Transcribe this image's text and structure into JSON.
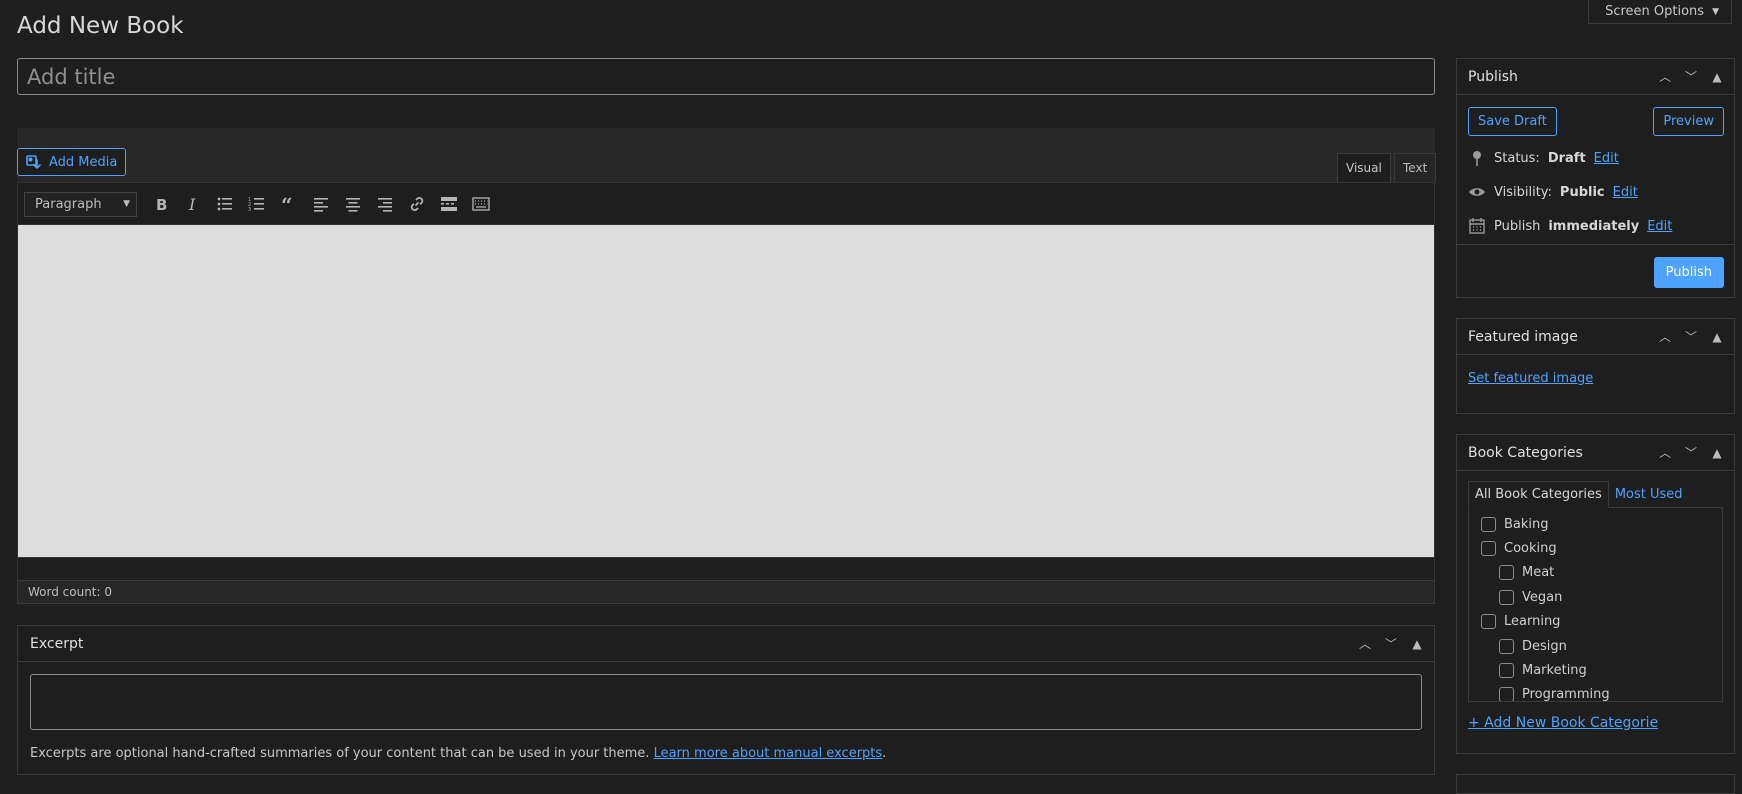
{
  "screen_options": {
    "label": "Screen Options"
  },
  "page": {
    "title": "Add New Book"
  },
  "title_field": {
    "placeholder": "Add title",
    "value": ""
  },
  "editor": {
    "add_media_label": "Add Media",
    "tabs": {
      "visual": "Visual",
      "text": "Text"
    },
    "format_select": "Paragraph",
    "word_count": "Word count: 0"
  },
  "excerpt": {
    "title": "Excerpt",
    "help_text": "Excerpts are optional hand-crafted summaries of your content that can be used in your theme. ",
    "help_link": "Learn more about manual excerpts",
    "help_end": "."
  },
  "publish": {
    "title": "Publish",
    "save_draft": "Save Draft",
    "preview": "Preview",
    "status_label": "Status: ",
    "status_value": "Draft",
    "visibility_label": "Visibility: ",
    "visibility_value": "Public",
    "publish_label": "Publish ",
    "publish_value": "immediately",
    "edit": "Edit",
    "publish_button": "Publish"
  },
  "featured_image": {
    "title": "Featured image",
    "set_link": "Set featured image"
  },
  "categories": {
    "title": "Book Categories",
    "tab_all": "All Book Categories",
    "tab_most_used": "Most Used",
    "items": [
      {
        "label": "Baking",
        "level": 0
      },
      {
        "label": "Cooking",
        "level": 0
      },
      {
        "label": "Meat",
        "level": 1
      },
      {
        "label": "Vegan",
        "level": 1
      },
      {
        "label": "Learning",
        "level": 0
      },
      {
        "label": "Design",
        "level": 1
      },
      {
        "label": "Marketing",
        "level": 1
      },
      {
        "label": "Programming",
        "level": 1
      }
    ],
    "add_new_link": "+ Add New Book Categorie"
  },
  "colors": {
    "accent": "#4da3ff",
    "background": "#1e1e1e",
    "editor_bg": "#dddddd"
  }
}
